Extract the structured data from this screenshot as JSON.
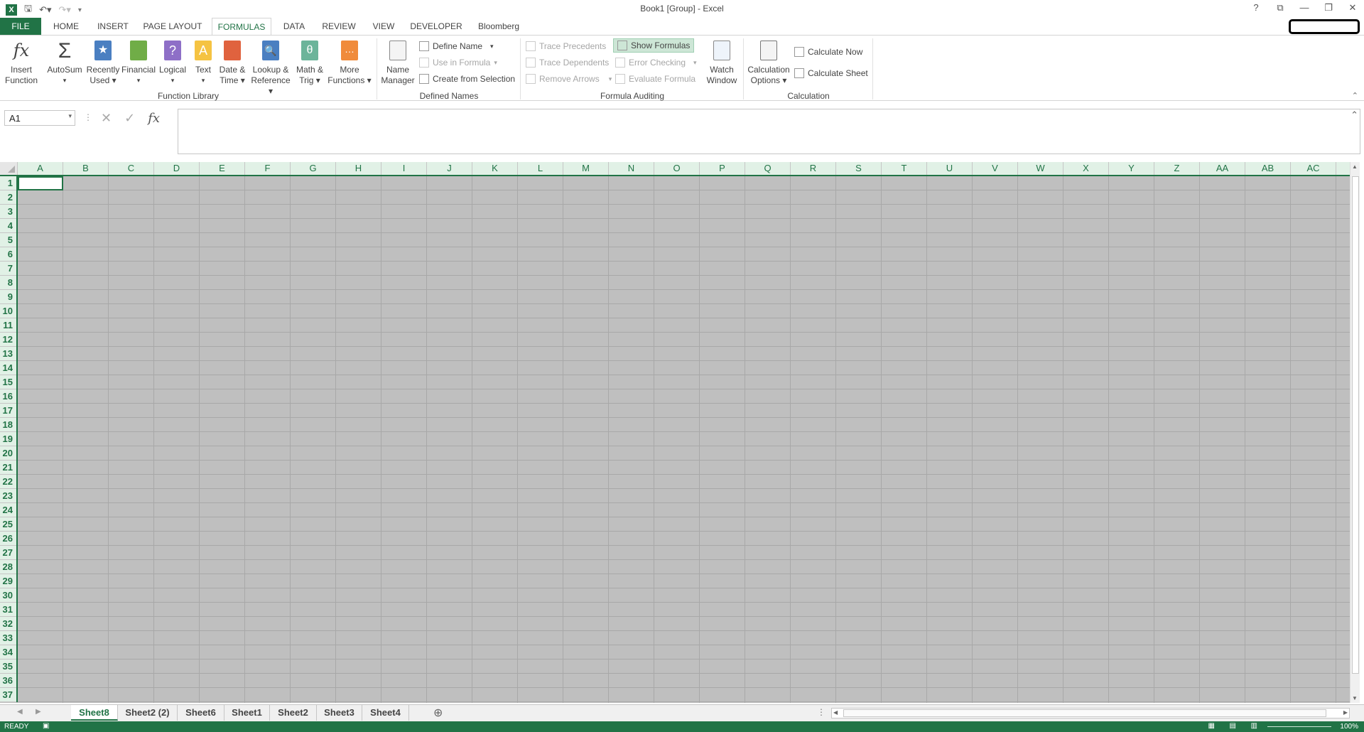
{
  "window": {
    "title": "Book1  [Group] - Excel",
    "help": "?",
    "controls": [
      "ribbon-display",
      "minimize",
      "restore",
      "close"
    ]
  },
  "tabs": [
    {
      "label": "FILE"
    },
    {
      "label": "HOME"
    },
    {
      "label": "INSERT"
    },
    {
      "label": "PAGE LAYOUT"
    },
    {
      "label": "FORMULAS"
    },
    {
      "label": "DATA"
    },
    {
      "label": "REVIEW"
    },
    {
      "label": "VIEW"
    },
    {
      "label": "DEVELOPER"
    },
    {
      "label": "Bloomberg"
    }
  ],
  "active_tab": "FORMULAS",
  "ribbon": {
    "function_library": {
      "label": "Function Library",
      "buttons": [
        {
          "line1": "Insert",
          "line2": "Function",
          "icon": "fx-icon"
        },
        {
          "line1": "AutoSum",
          "line2": "▾",
          "icon": "sigma-icon"
        },
        {
          "line1": "Recently",
          "line2": "Used ▾",
          "icon": "star-book-icon"
        },
        {
          "line1": "Financial",
          "line2": "▾",
          "icon": "financial-icon"
        },
        {
          "line1": "Logical",
          "line2": "▾",
          "icon": "question-book-icon"
        },
        {
          "line1": "Text",
          "line2": "▾",
          "icon": "text-book-icon"
        },
        {
          "line1": "Date &",
          "line2": "Time ▾",
          "icon": "calendar-book-icon"
        },
        {
          "line1": "Lookup &",
          "line2": "Reference ▾",
          "icon": "lookup-book-icon"
        },
        {
          "line1": "Math &",
          "line2": "Trig ▾",
          "icon": "theta-book-icon"
        },
        {
          "line1": "More",
          "line2": "Functions ▾",
          "icon": "more-book-icon"
        }
      ]
    },
    "defined_names": {
      "label": "Defined Names",
      "name_manager": {
        "line1": "Name",
        "line2": "Manager"
      },
      "define_name": "Define Name",
      "use_in_formula": "Use in Formula",
      "create_from_selection": "Create from Selection"
    },
    "formula_auditing": {
      "label": "Formula Auditing",
      "trace_precedents": "Trace Precedents",
      "trace_dependents": "Trace Dependents",
      "remove_arrows": "Remove Arrows",
      "show_formulas": "Show Formulas",
      "error_checking": "Error Checking",
      "evaluate_formula": "Evaluate Formula",
      "watch_window": {
        "line1": "Watch",
        "line2": "Window"
      }
    },
    "calculation": {
      "label": "Calculation",
      "options": {
        "line1": "Calculation",
        "line2": "Options ▾"
      },
      "calculate_now": "Calculate Now",
      "calculate_sheet": "Calculate Sheet"
    }
  },
  "formula_bar": {
    "name_box": "A1",
    "formula": ""
  },
  "columns": [
    "A",
    "B",
    "C",
    "D",
    "E",
    "F",
    "G",
    "H",
    "I",
    "J",
    "K",
    "L",
    "M",
    "N",
    "O",
    "P",
    "Q",
    "R",
    "S",
    "T",
    "U",
    "V",
    "W",
    "X",
    "Y",
    "Z",
    "AA",
    "AB",
    "AC"
  ],
  "rows": [
    "1",
    "2",
    "3",
    "4",
    "5",
    "6",
    "7",
    "8",
    "9",
    "10",
    "11",
    "12",
    "13",
    "14",
    "15",
    "16",
    "17",
    "18",
    "19",
    "20",
    "21",
    "22",
    "23",
    "24",
    "25",
    "26",
    "27",
    "28",
    "29",
    "30",
    "31",
    "32",
    "33",
    "34",
    "35",
    "36",
    "37"
  ],
  "sheets": [
    {
      "label": "Sheet8",
      "active": true
    },
    {
      "label": "Sheet2 (2)"
    },
    {
      "label": "Sheet6"
    },
    {
      "label": "Sheet1"
    },
    {
      "label": "Sheet2"
    },
    {
      "label": "Sheet3"
    },
    {
      "label": "Sheet4"
    }
  ],
  "status": {
    "mode": "READY",
    "zoom": "100%"
  },
  "colors": {
    "accent": "#217346",
    "selected_sheets_bg": "#bfbfbf",
    "header_bg": "#e1f1e6"
  }
}
